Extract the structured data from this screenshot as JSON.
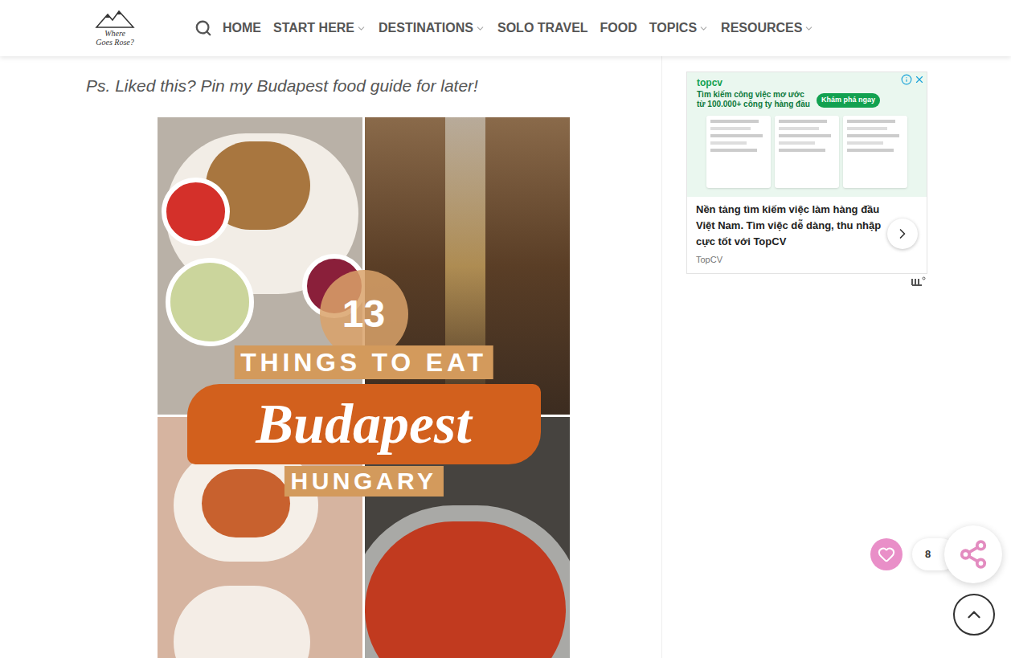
{
  "header": {
    "logo": {
      "line1": "Where",
      "line2": "Goes Rose?"
    },
    "nav": [
      {
        "label": "HOME",
        "has_menu": false
      },
      {
        "label": "START HERE",
        "has_menu": true
      },
      {
        "label": "DESTINATIONS",
        "has_menu": true
      },
      {
        "label": "SOLO TRAVEL",
        "has_menu": false
      },
      {
        "label": "FOOD",
        "has_menu": false
      },
      {
        "label": "TOPICS",
        "has_menu": true
      },
      {
        "label": "RESOURCES",
        "has_menu": true
      }
    ]
  },
  "article": {
    "note": "Ps. Liked this? Pin my Budapest food guide for later!",
    "pin": {
      "number": "13",
      "line1": "THINGS TO EAT",
      "title": "Budapest",
      "subtitle": "HUNGARY"
    }
  },
  "ad": {
    "brand": "topcv",
    "headline_lines": [
      "Tìm kiếm công việc mơ ước",
      "từ 100.000+ công ty hàng đầu"
    ],
    "cta": "Khám phá ngay",
    "text": "Nền tảng tìm kiếm việc làm hàng đầu Việt Nam. Tìm việc dễ dàng, thu nhập cực tốt với TopCV",
    "advertiser": "TopCV"
  },
  "floating": {
    "likes": "8"
  }
}
